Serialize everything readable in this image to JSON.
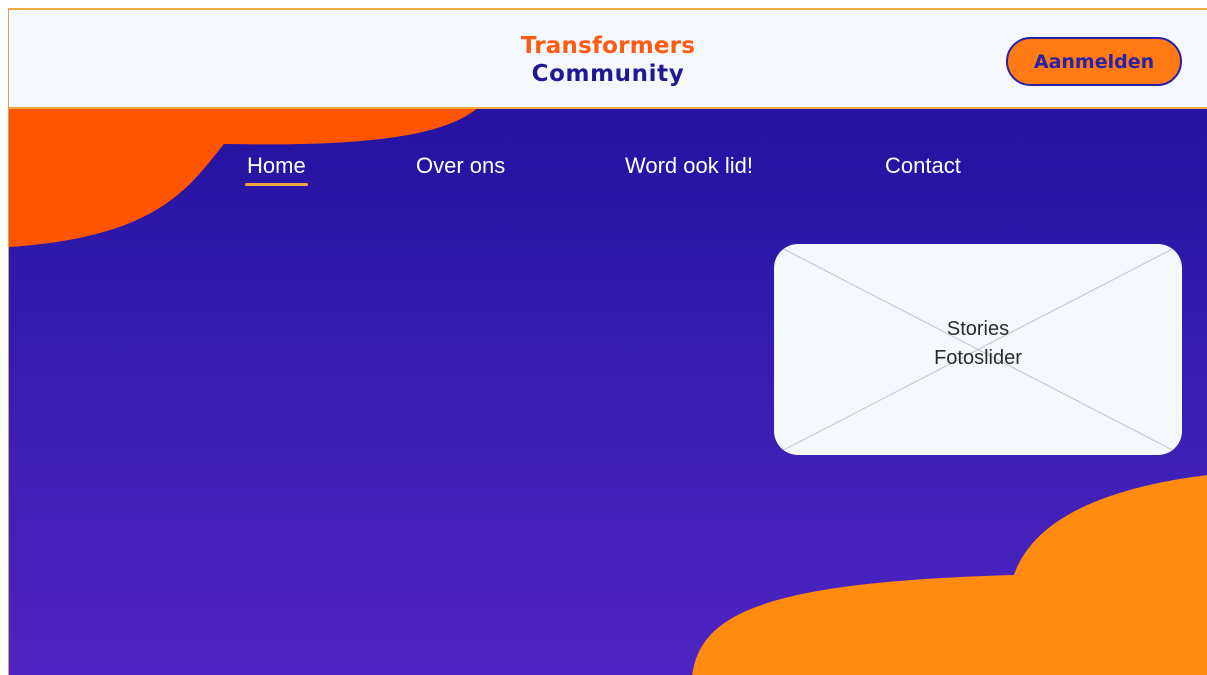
{
  "header": {
    "logo_line1": "Transformers",
    "logo_line2": "Community",
    "login_label": "Aanmelden"
  },
  "nav": {
    "items": [
      {
        "label": "Home",
        "active": true
      },
      {
        "label": "Over ons",
        "active": false
      },
      {
        "label": "Word ook lid!",
        "active": false
      },
      {
        "label": "Contact",
        "active": false
      }
    ]
  },
  "placeholder": {
    "line1": "Stories",
    "line2": "Fotoslider"
  },
  "colors": {
    "brand_orange": "#ff5a12",
    "brand_navy": "#1e1a93",
    "accent_amber": "#ff8c10",
    "hero_top": "#2412a0",
    "hero_bottom": "#5024c4"
  }
}
